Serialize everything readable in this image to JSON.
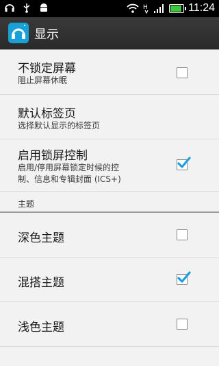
{
  "status_bar": {
    "time": "11:24"
  },
  "action_bar": {
    "title": "显示"
  },
  "prefs": [
    {
      "title": "不锁定屏幕",
      "summary": "阻止屏幕休眠",
      "checked": false
    },
    {
      "title": "默认标签页",
      "summary": "选择默认显示的标签页"
    },
    {
      "title": "启用锁屏控制",
      "summary_line1": "启用/停用屏幕锁定时候的控",
      "summary_line2": "制、信息和专辑封面 (ICS+)",
      "checked": true
    }
  ],
  "section": {
    "label": "主题"
  },
  "themes": [
    {
      "title": "深色主题",
      "checked": false
    },
    {
      "title": "混搭主题",
      "checked": true
    },
    {
      "title": "浅色主题",
      "checked": false
    }
  ],
  "colors": {
    "accent": "#19a0d8",
    "check": "#1e9de0"
  }
}
